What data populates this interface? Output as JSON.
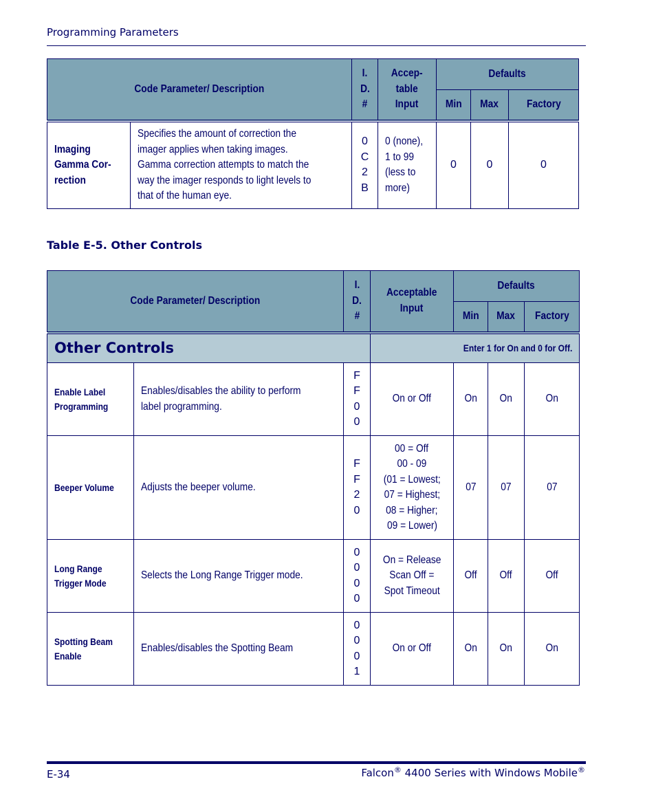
{
  "running_head": "Programming Parameters",
  "table1": {
    "headers": {
      "code_param": "Code Parameter/ Description",
      "id": [
        "I.",
        "D.",
        "#"
      ],
      "acceptable": [
        "Accep-",
        "table",
        "Input"
      ],
      "defaults": "Defaults",
      "min": "Min",
      "max": "Max",
      "factory": "Factory"
    },
    "rows": [
      {
        "name": [
          "Imaging",
          "Gamma Cor-",
          "rection"
        ],
        "description": [
          "Specifies the amount of correction the",
          "imager applies when taking images.",
          "Gamma correction attempts to match the",
          "way the imager responds to light levels to",
          "that of the human eye."
        ],
        "id": [
          "0",
          "C",
          "2",
          "B"
        ],
        "acceptable": [
          "0 (none),",
          "1 to 99",
          "(less to",
          "more)"
        ],
        "min": "0",
        "max": "0",
        "factory": "0"
      }
    ]
  },
  "table2": {
    "caption": "Table E-5. Other Controls",
    "headers": {
      "code_param": "Code Parameter/ Description",
      "id": [
        "I.",
        "D.",
        "#"
      ],
      "acceptable": [
        "Acceptable",
        "Input"
      ],
      "defaults": "Defaults",
      "min": "Min",
      "max": "Max",
      "factory": "Factory"
    },
    "section": {
      "title": "Other Controls",
      "note": "Enter 1 for On and 0 for Off."
    },
    "rows": [
      {
        "name": [
          "Enable Label",
          "Programming"
        ],
        "description": [
          "Enables/disables the ability to perform",
          "label programming."
        ],
        "id": [
          "F",
          "F",
          "0",
          "0"
        ],
        "acceptable": [
          "On or Off"
        ],
        "min": "On",
        "max": "On",
        "factory": "On"
      },
      {
        "name": [
          "Beeper Volume"
        ],
        "description": [
          "Adjusts the beeper volume."
        ],
        "id": [
          "F",
          "F",
          "2",
          "0"
        ],
        "acceptable": [
          "00 = Off",
          "00 - 09",
          "(01 = Lowest;",
          "07 = Highest;",
          "08 = Higher;",
          "09 = Lower)"
        ],
        "min": "07",
        "max": "07",
        "factory": "07"
      },
      {
        "name": [
          "Long Range",
          "Trigger Mode"
        ],
        "description": [
          "Selects the Long Range Trigger mode."
        ],
        "id": [
          "0",
          "0",
          "0",
          "0"
        ],
        "acceptable": [
          "On = Release",
          "Scan Off =",
          "Spot Timeout"
        ],
        "min": "Off",
        "max": "Off",
        "factory": "Off"
      },
      {
        "name": [
          "Spotting Beam",
          "Enable"
        ],
        "description": [
          "Enables/disables the Spotting Beam"
        ],
        "id": [
          "0",
          "0",
          "0",
          "1"
        ],
        "acceptable": [
          "On or Off"
        ],
        "min": "On",
        "max": "On",
        "factory": "On"
      }
    ]
  },
  "footer": {
    "page_number": "E-34",
    "product_part1": "Falcon",
    "registered": "®",
    "product_part2": " 4400 Series with Windows Mobile"
  }
}
